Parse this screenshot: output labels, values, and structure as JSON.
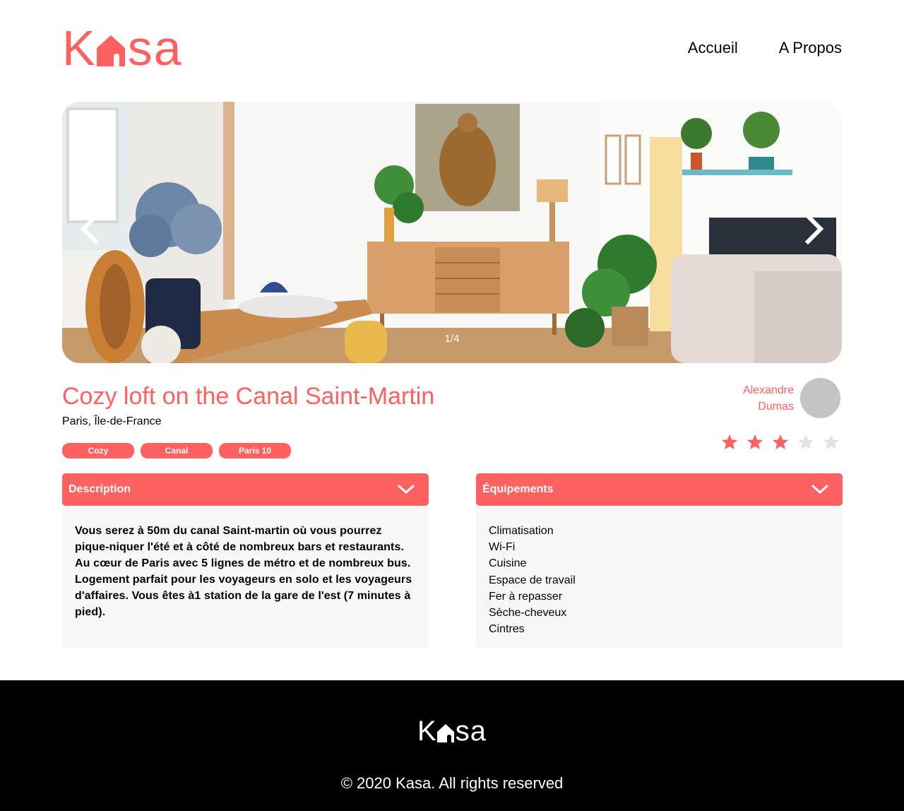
{
  "brand": {
    "logo_left": "K",
    "logo_right": "sa",
    "accent_color": "#FF6060"
  },
  "nav": {
    "items": [
      {
        "label": "Accueil"
      },
      {
        "label": "A Propos"
      }
    ]
  },
  "gallery": {
    "counter": "1/4",
    "prev_icon": "chevron-left-icon",
    "next_icon": "chevron-right-icon"
  },
  "listing": {
    "title": "Cozy loft on the Canal Saint-Martin",
    "location": "Paris, Île-de-France",
    "tags": [
      "Cozy",
      "Canal",
      "Paris 10"
    ],
    "host": {
      "first_name": "Alexandre",
      "last_name": "Dumas"
    },
    "rating": 3,
    "rating_max": 5
  },
  "description": {
    "heading": "Description",
    "text": "Vous serez à 50m du canal Saint-martin où vous pourrez pique-niquer l'été et à côté de nombreux bars et restaurants. Au cœur de Paris avec 5 lignes de métro et de nombreux bus. Logement parfait pour les voyageurs en solo et les voyageurs d'affaires. Vous êtes à1 station de la gare de l'est (7 minutes à pied)."
  },
  "equipments": {
    "heading": "Équipements",
    "items": [
      "Climatisation",
      "Wi-Fi",
      "Cuisine",
      "Espace de travail",
      "Fer à repasser",
      "Sèche-cheveux",
      "Cintres"
    ]
  },
  "footer": {
    "logo_left": "K",
    "logo_right": "sa",
    "copyright": "© 2020 Kasa. All rights reserved"
  }
}
